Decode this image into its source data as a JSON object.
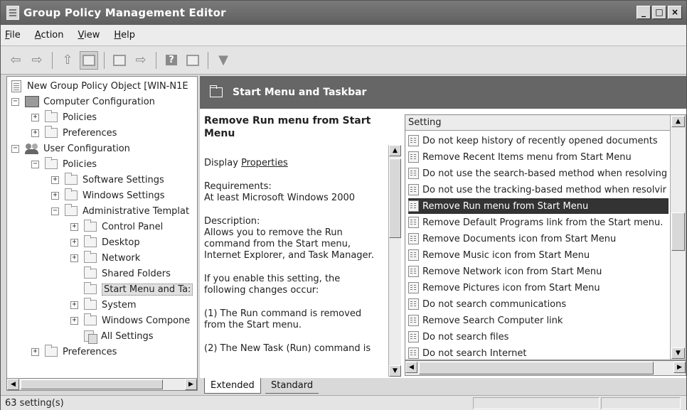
{
  "window": {
    "title": "Group Policy Management Editor",
    "buttons": [
      "_",
      "□",
      "×"
    ]
  },
  "menubar": {
    "items": [
      "File",
      "Action",
      "View",
      "Help"
    ]
  },
  "toolbar": {
    "icons": [
      "back-icon",
      "forward-icon",
      "up-folder-icon",
      "show-hide-tree-icon",
      "properties-icon",
      "export-list-icon",
      "help-icon",
      "console-tree-icon",
      "filter-icon"
    ]
  },
  "tree": {
    "root": "New Group Policy Object [WIN-N1E",
    "computer_configuration": "Computer Configuration",
    "comp_policies": "Policies",
    "comp_preferences": "Preferences",
    "user_configuration": "User Configuration",
    "user_policies": "Policies",
    "software_settings": "Software Settings",
    "windows_settings": "Windows Settings",
    "administrative_templates": "Administrative Templat",
    "control_panel": "Control Panel",
    "desktop": "Desktop",
    "network": "Network",
    "shared_folders": "Shared Folders",
    "start_menu_and_taskbar": "Start Menu and Ta:",
    "system": "System",
    "windows_components": "Windows Compone",
    "all_settings": "All Settings",
    "user_preferences": "Preferences"
  },
  "right_pane": {
    "header_title": "Start Menu and Taskbar"
  },
  "description": {
    "title": "Remove Run menu from Start Menu",
    "display_prefix": "Display ",
    "display_link": "Properties",
    "requirements_label": "Requirements:",
    "requirements_value": "At least Microsoft Windows 2000",
    "description_label": "Description:",
    "description_value": "Allows you to remove the Run command from the Start menu, Internet Explorer, and Task Manager.",
    "enable_text": "If you enable this setting, the following changes occur:",
    "change_1": "(1) The Run command is removed from the Start menu.",
    "change_2": "(2) The New Task (Run) command is"
  },
  "settings_list": {
    "column_header": "Setting",
    "selected_index": 4,
    "rows": [
      "Do not keep history of recently opened documents",
      "Remove Recent Items menu from Start Menu",
      "Do not use the search-based method when resolving",
      "Do not use the tracking-based method when resolvir",
      "Remove Run menu from Start Menu",
      "Remove Default Programs link from the Start menu.",
      "Remove Documents icon from Start Menu",
      "Remove Music icon from Start Menu",
      "Remove Network icon from Start Menu",
      "Remove Pictures icon from Start Menu",
      "Do not search communications",
      "Remove Search Computer link",
      "Do not search files",
      "Do not search Internet"
    ]
  },
  "tabs": {
    "extended": "Extended",
    "standard": "Standard",
    "active": "Extended"
  },
  "statusbar": {
    "text": "63 setting(s)"
  }
}
